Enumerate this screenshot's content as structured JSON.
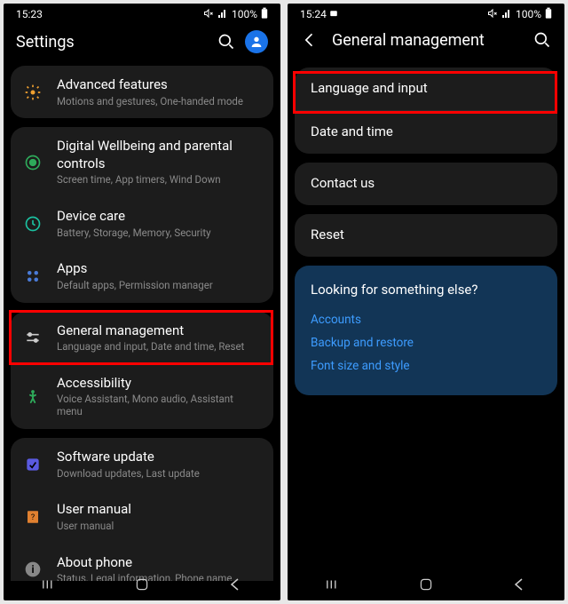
{
  "left": {
    "status": {
      "time": "15:23",
      "battery": "100%",
      "icons": [
        "mute",
        "signal",
        "battery"
      ]
    },
    "header": {
      "title": "Settings"
    },
    "items": [
      {
        "icon": "advanced",
        "title": "Advanced features",
        "sub": "Motions and gestures, One-handed mode"
      },
      {
        "icon": "wellbeing",
        "title": "Digital Wellbeing and parental controls",
        "sub": "Screen time, App timers, Wind Down"
      },
      {
        "icon": "devicecare",
        "title": "Device care",
        "sub": "Battery, Storage, Memory, Security"
      },
      {
        "icon": "apps",
        "title": "Apps",
        "sub": "Default apps, Permission manager"
      },
      {
        "icon": "general",
        "title": "General management",
        "sub": "Language and input, Date and time, Reset",
        "highlighted": true
      },
      {
        "icon": "accessibility",
        "title": "Accessibility",
        "sub": "Voice Assistant, Mono audio, Assistant menu"
      },
      {
        "icon": "update",
        "title": "Software update",
        "sub": "Download updates, Last update"
      },
      {
        "icon": "manual",
        "title": "User manual",
        "sub": "User manual"
      },
      {
        "icon": "about",
        "title": "About phone",
        "sub": "Status, Legal information, Phone name"
      }
    ]
  },
  "right": {
    "status": {
      "time": "15:24",
      "battery": "100%"
    },
    "header": {
      "title": "General management"
    },
    "items": [
      {
        "title": "Language and input",
        "highlighted": true
      },
      {
        "title": "Date and time"
      },
      {
        "title": "Contact us"
      },
      {
        "title": "Reset"
      }
    ],
    "else": {
      "title": "Looking for something else?",
      "links": [
        "Accounts",
        "Backup and restore",
        "Font size and style"
      ]
    }
  }
}
